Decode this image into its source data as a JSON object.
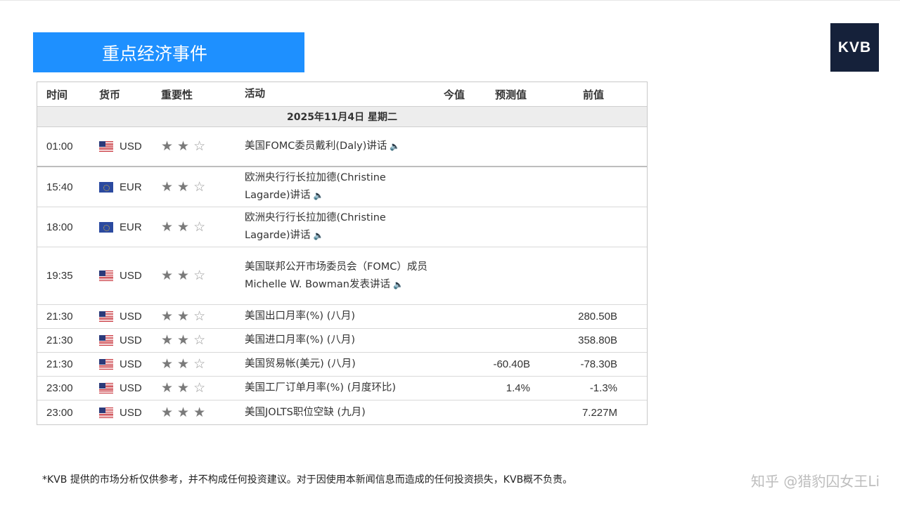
{
  "banner": {
    "title": "重点经济事件"
  },
  "logo": {
    "text": "KVB"
  },
  "table": {
    "headers": {
      "time": "时间",
      "currency": "货币",
      "importance": "重要性",
      "event": "活动",
      "actual": "今值",
      "forecast": "预测值",
      "previous": "前值"
    },
    "date": "2025年11月4日  星期二",
    "rows": [
      {
        "time": "01:00",
        "flag": "us",
        "currency": "USD",
        "stars": 2,
        "event": "美国FOMC委员戴利(Daly)讲话",
        "audio": true,
        "actual": "",
        "forecast": "",
        "previous": ""
      },
      {
        "time": "15:40",
        "flag": "eu",
        "currency": "EUR",
        "stars": 2,
        "event": "欧洲央行行长拉加德(Christine Lagarde)讲话",
        "audio": true,
        "actual": "",
        "forecast": "",
        "previous": ""
      },
      {
        "time": "18:00",
        "flag": "eu",
        "currency": "EUR",
        "stars": 2,
        "event": "欧洲央行行长拉加德(Christine Lagarde)讲话",
        "audio": true,
        "actual": "",
        "forecast": "",
        "previous": ""
      },
      {
        "time": "19:35",
        "flag": "us",
        "currency": "USD",
        "stars": 2,
        "event": "美国联邦公开市场委员会（FOMC）成员Michelle W. Bowman发表讲话",
        "audio": true,
        "actual": "",
        "forecast": "",
        "previous": ""
      },
      {
        "time": "21:30",
        "flag": "us",
        "currency": "USD",
        "stars": 2,
        "event": "美国出口月率(%) (八月)",
        "audio": false,
        "actual": "",
        "forecast": "",
        "previous": "280.50B"
      },
      {
        "time": "21:30",
        "flag": "us",
        "currency": "USD",
        "stars": 2,
        "event": "美国进口月率(%) (八月)",
        "audio": false,
        "actual": "",
        "forecast": "",
        "previous": "358.80B"
      },
      {
        "time": "21:30",
        "flag": "us",
        "currency": "USD",
        "stars": 2,
        "event": "美国贸易帐(美元) (八月)",
        "audio": false,
        "actual": "",
        "forecast": "-60.40B",
        "previous": "-78.30B"
      },
      {
        "time": "23:00",
        "flag": "us",
        "currency": "USD",
        "stars": 2,
        "event": "美国工厂订单月率(%) (月度环比)",
        "audio": false,
        "actual": "",
        "forecast": "1.4%",
        "previous": "-1.3%"
      },
      {
        "time": "23:00",
        "flag": "us",
        "currency": "USD",
        "stars": 3,
        "event": "美国JOLTS职位空缺 (九月)",
        "audio": false,
        "actual": "",
        "forecast": "",
        "previous": "7.227M"
      }
    ]
  },
  "disclaimer": "*KVB 提供的市场分析仅供参考，并不构成任何投资建议。对于因使用本新闻信息而造成的任何投资损失，KVB概不负责。",
  "watermark": "知乎 @猎豹囚女王Li"
}
